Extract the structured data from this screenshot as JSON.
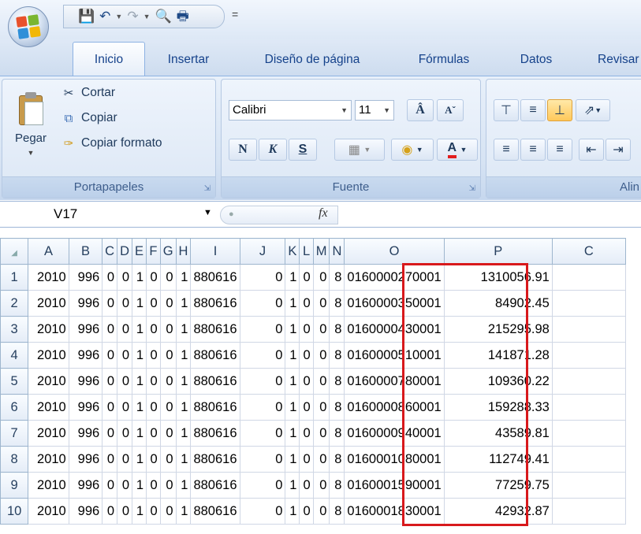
{
  "quick_access": {
    "save_icon": "floppy-disk-icon",
    "undo_icon": "undo-icon",
    "redo_icon": "redo-icon",
    "preview_icon": "print-preview-icon",
    "print_icon": "printer-icon",
    "customize": "="
  },
  "tabs": [
    "Inicio",
    "Insertar",
    "Diseño de página",
    "Fórmulas",
    "Datos",
    "Revisar"
  ],
  "ribbon": {
    "clipboard": {
      "paste": "Pegar",
      "cut": "Cortar",
      "copy": "Copiar",
      "format_painter": "Copiar formato",
      "group": "Portapapeles"
    },
    "font": {
      "name": "Calibri",
      "size": "11",
      "bold": "N",
      "italic": "K",
      "underline": "S",
      "group": "Fuente"
    },
    "alignment": {
      "group": "Alin"
    }
  },
  "formula_bar": {
    "name_box": "V17",
    "fx": "fx",
    "value": ""
  },
  "columns": [
    "A",
    "B",
    "C",
    "D",
    "E",
    "F",
    "G",
    "H",
    "I",
    "J",
    "K",
    "L",
    "M",
    "N",
    "O",
    "P",
    "C"
  ],
  "rows": [
    {
      "n": "1",
      "cells": [
        "2010",
        "996",
        "0",
        "0",
        "1",
        "0",
        "0",
        "1",
        "880616",
        "0",
        "1",
        "0",
        "0",
        "8",
        "0160000270001",
        "1310056.91"
      ]
    },
    {
      "n": "2",
      "cells": [
        "2010",
        "996",
        "0",
        "0",
        "1",
        "0",
        "0",
        "1",
        "880616",
        "0",
        "1",
        "0",
        "0",
        "8",
        "0160000350001",
        "84902.45"
      ]
    },
    {
      "n": "3",
      "cells": [
        "2010",
        "996",
        "0",
        "0",
        "1",
        "0",
        "0",
        "1",
        "880616",
        "0",
        "1",
        "0",
        "0",
        "8",
        "0160000430001",
        "215295.98"
      ]
    },
    {
      "n": "4",
      "cells": [
        "2010",
        "996",
        "0",
        "0",
        "1",
        "0",
        "0",
        "1",
        "880616",
        "0",
        "1",
        "0",
        "0",
        "8",
        "0160000510001",
        "141871.28"
      ]
    },
    {
      "n": "5",
      "cells": [
        "2010",
        "996",
        "0",
        "0",
        "1",
        "0",
        "0",
        "1",
        "880616",
        "0",
        "1",
        "0",
        "0",
        "8",
        "0160000780001",
        "109360.22"
      ]
    },
    {
      "n": "6",
      "cells": [
        "2010",
        "996",
        "0",
        "0",
        "1",
        "0",
        "0",
        "1",
        "880616",
        "0",
        "1",
        "0",
        "0",
        "8",
        "0160000860001",
        "159288.33"
      ]
    },
    {
      "n": "7",
      "cells": [
        "2010",
        "996",
        "0",
        "0",
        "1",
        "0",
        "0",
        "1",
        "880616",
        "0",
        "1",
        "0",
        "0",
        "8",
        "0160000940001",
        "43589.81"
      ]
    },
    {
      "n": "8",
      "cells": [
        "2010",
        "996",
        "0",
        "0",
        "1",
        "0",
        "0",
        "1",
        "880616",
        "0",
        "1",
        "0",
        "0",
        "8",
        "0160001080001",
        "112749.41"
      ]
    },
    {
      "n": "9",
      "cells": [
        "2010",
        "996",
        "0",
        "0",
        "1",
        "0",
        "0",
        "1",
        "880616",
        "0",
        "1",
        "0",
        "0",
        "8",
        "0160001590001",
        "77259.75"
      ]
    },
    {
      "n": "10",
      "cells": [
        "2010",
        "996",
        "0",
        "0",
        "1",
        "0",
        "0",
        "1",
        "880616",
        "0",
        "1",
        "0",
        "0",
        "8",
        "0160001830001",
        "42932.87"
      ]
    }
  ],
  "colors": {
    "highlight": "#d8191c",
    "tab_text": "#15428b",
    "ribbon_bg": "#dce7f5"
  }
}
